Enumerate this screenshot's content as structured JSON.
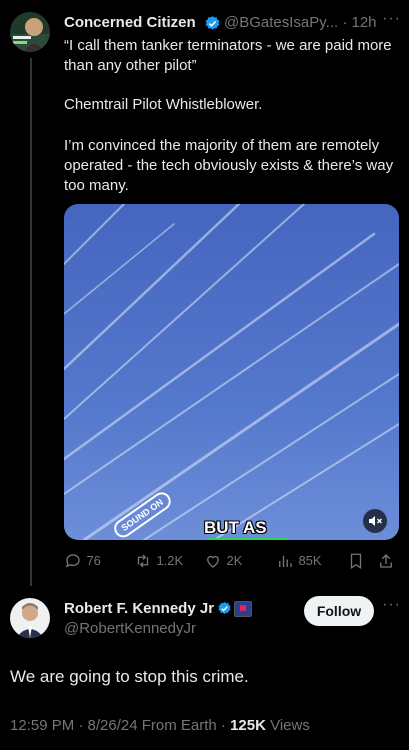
{
  "tweet1": {
    "display_name": "Concerned Citizen",
    "handle_time": "@BGatesIsaPy... · 12h",
    "more": "···",
    "p1": "“I call them tanker terminators - we are paid more than any other pilot”",
    "p2": "Chemtrail Pilot Whistleblower.",
    "p3": "I’m convinced the majority of them are remotely operated - the tech obviously exists & there’s way too many.",
    "media": {
      "sticker_text": "SOUND ON",
      "caption": "BUT AS",
      "mute_icon": "mute-icon"
    },
    "actions": {
      "replies": "76",
      "retweets": "1.2K",
      "likes": "2K",
      "views": "85K"
    }
  },
  "tweet2": {
    "display_name": "Robert F. Kennedy Jr",
    "handle": "@RobertKennedyJr",
    "follow_label": "Follow",
    "more": "···",
    "text": "We are going to stop this crime.",
    "meta_prefix": "12:59 PM · 8/26/24 From Earth · ",
    "views_count": "125K",
    "views_label": " Views"
  },
  "colors": {
    "verified": "#1d9bf0",
    "muted": "#71767b",
    "sky": "#4e72c6"
  }
}
